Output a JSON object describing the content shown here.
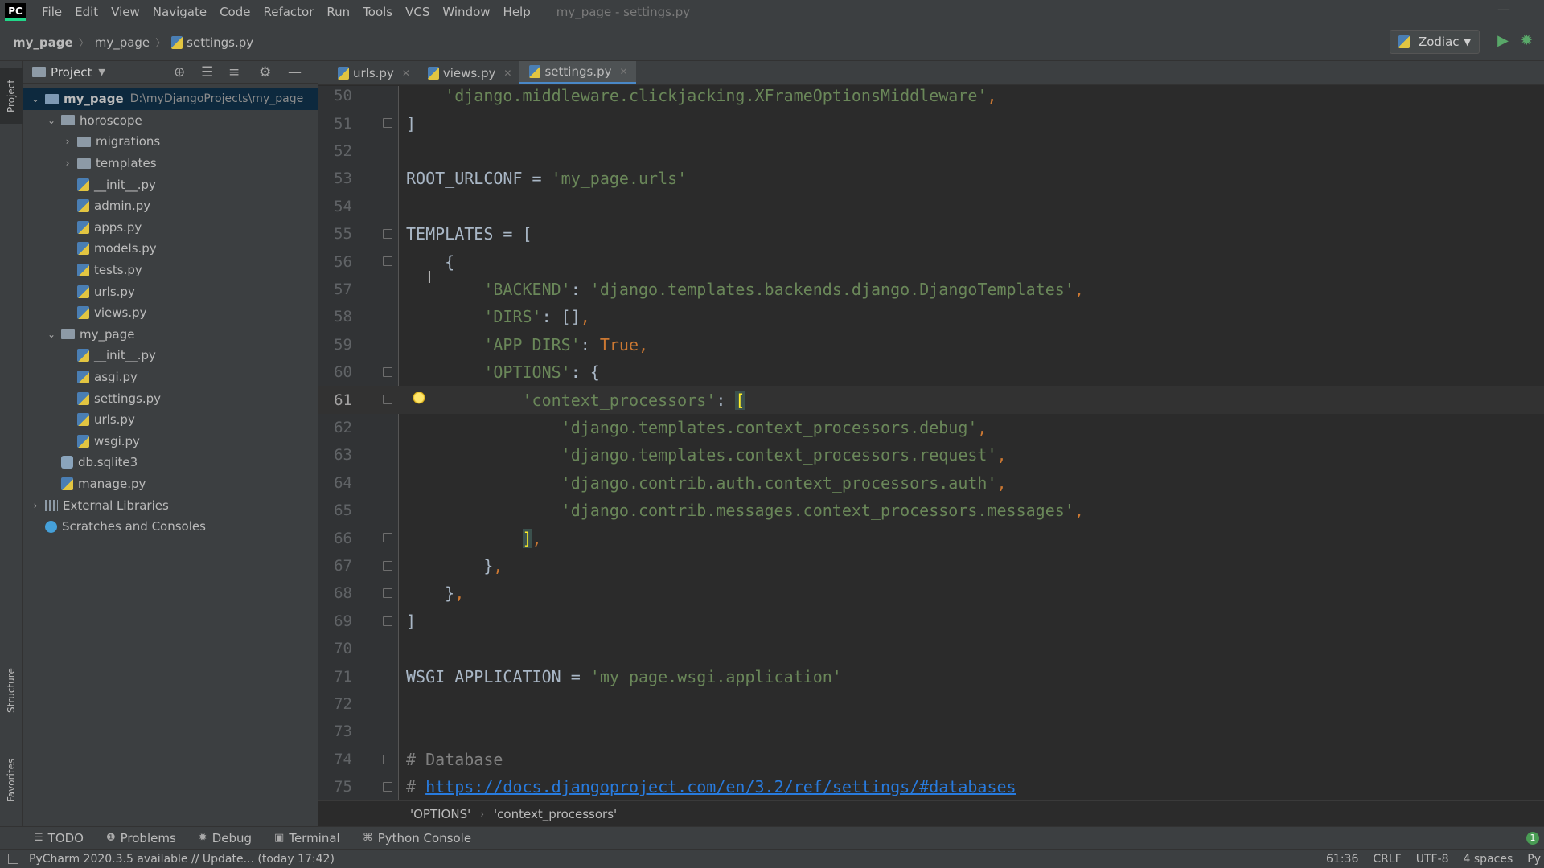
{
  "menubar": {
    "logo": "PC",
    "items": [
      "File",
      "Edit",
      "View",
      "Navigate",
      "Code",
      "Refactor",
      "Run",
      "Tools",
      "VCS",
      "Window",
      "Help"
    ],
    "window_title": "my_page - settings.py"
  },
  "navbar": {
    "crumbs": [
      "my_page",
      "my_page",
      "settings.py"
    ],
    "run_config": "Zodiac"
  },
  "side_tabs": {
    "project": "Project",
    "structure": "Structure",
    "favorites": "Favorites"
  },
  "project_panel": {
    "title": "Project",
    "tree": [
      {
        "label": "my_page",
        "path": "D:\\myDjangoProjects\\my_page",
        "depth": 0,
        "type": "root",
        "expanded": true,
        "selected": true
      },
      {
        "label": "horoscope",
        "depth": 1,
        "type": "folder",
        "expanded": true
      },
      {
        "label": "migrations",
        "depth": 2,
        "type": "folder",
        "expanded": false
      },
      {
        "label": "templates",
        "depth": 2,
        "type": "folder",
        "expanded": false
      },
      {
        "label": "__init__.py",
        "depth": 2,
        "type": "py"
      },
      {
        "label": "admin.py",
        "depth": 2,
        "type": "py"
      },
      {
        "label": "apps.py",
        "depth": 2,
        "type": "py"
      },
      {
        "label": "models.py",
        "depth": 2,
        "type": "py"
      },
      {
        "label": "tests.py",
        "depth": 2,
        "type": "py"
      },
      {
        "label": "urls.py",
        "depth": 2,
        "type": "py"
      },
      {
        "label": "views.py",
        "depth": 2,
        "type": "py"
      },
      {
        "label": "my_page",
        "depth": 1,
        "type": "folder",
        "expanded": true
      },
      {
        "label": "__init__.py",
        "depth": 2,
        "type": "py"
      },
      {
        "label": "asgi.py",
        "depth": 2,
        "type": "py"
      },
      {
        "label": "settings.py",
        "depth": 2,
        "type": "py"
      },
      {
        "label": "urls.py",
        "depth": 2,
        "type": "py"
      },
      {
        "label": "wsgi.py",
        "depth": 2,
        "type": "py"
      },
      {
        "label": "db.sqlite3",
        "depth": 1,
        "type": "db"
      },
      {
        "label": "manage.py",
        "depth": 1,
        "type": "py"
      },
      {
        "label": "External Libraries",
        "depth": 0,
        "type": "lib",
        "expanded": false
      },
      {
        "label": "Scratches and Consoles",
        "depth": 0,
        "type": "scratch"
      }
    ]
  },
  "tabs": [
    {
      "label": "urls.py",
      "active": false
    },
    {
      "label": "views.py",
      "active": false
    },
    {
      "label": "settings.py",
      "active": true
    }
  ],
  "editor": {
    "current_line": 61,
    "lines": [
      {
        "n": "50",
        "html": "    <span class=\"s\">'django.middleware.clickjacking.XFrameOptionsMiddleware'</span><span class=\"k\">,</span>"
      },
      {
        "n": "51",
        "html": "]",
        "fold": true
      },
      {
        "n": "52",
        "html": ""
      },
      {
        "n": "53",
        "html": "ROOT_URLCONF = <span class=\"s\">'my_page.urls'</span>"
      },
      {
        "n": "54",
        "html": ""
      },
      {
        "n": "55",
        "html": "TEMPLATES = [",
        "fold": true
      },
      {
        "n": "56",
        "html": "    {",
        "fold": true
      },
      {
        "n": "57",
        "html": "        <span class=\"s\">'BACKEND'</span>: <span class=\"s\">'django.templates.backends.django.DjangoTemplates'</span><span class=\"k\">,</span>"
      },
      {
        "n": "58",
        "html": "        <span class=\"s\">'DIRS'</span>: []<span class=\"k\">,</span>"
      },
      {
        "n": "59",
        "html": "        <span class=\"s\">'APP_DIRS'</span>: <span class=\"k\">True,</span>"
      },
      {
        "n": "60",
        "html": "        <span class=\"s\">'OPTIONS'</span>: {",
        "fold": true
      },
      {
        "n": "61",
        "html": "            <span class=\"s\">'context_processors'</span>: <span class=\"bk\">[</span>",
        "fold": true,
        "bulb": true
      },
      {
        "n": "62",
        "html": "                <span class=\"s\">'django.templates.context_processors.debug'</span><span class=\"k\">,</span>"
      },
      {
        "n": "63",
        "html": "                <span class=\"s\">'django.templates.context_processors.request'</span><span class=\"k\">,</span>"
      },
      {
        "n": "64",
        "html": "                <span class=\"s\">'django.contrib.auth.context_processors.auth'</span><span class=\"k\">,</span>"
      },
      {
        "n": "65",
        "html": "                <span class=\"s\">'django.contrib.messages.context_processors.messages'</span><span class=\"k\">,</span>"
      },
      {
        "n": "66",
        "html": "            <span class=\"bk\">]</span><span class=\"k\">,</span>",
        "fold": true
      },
      {
        "n": "67",
        "html": "        }<span class=\"k\">,</span>",
        "fold": true
      },
      {
        "n": "68",
        "html": "    }<span class=\"k\">,</span>",
        "fold": true
      },
      {
        "n": "69",
        "html": "]",
        "fold": true
      },
      {
        "n": "70",
        "html": ""
      },
      {
        "n": "71",
        "html": "WSGI_APPLICATION = <span class=\"s\">'my_page.wsgi.application'</span>"
      },
      {
        "n": "72",
        "html": ""
      },
      {
        "n": "73",
        "html": ""
      },
      {
        "n": "74",
        "html": "<span class=\"c\"># Database</span>",
        "fold": true
      },
      {
        "n": "75",
        "html": "<span class=\"c\"># </span><span class=\"u\">https://docs.djangoproject.com/en/3.2/ref/settings/#databases</span>",
        "fold": true
      }
    ]
  },
  "editor_breadcrumb": [
    "'OPTIONS'",
    "'context_processors'"
  ],
  "tool_windows": [
    {
      "label": "TODO",
      "icon": "list-icon"
    },
    {
      "label": "Problems",
      "icon": "problems-icon"
    },
    {
      "label": "Debug",
      "icon": "bug-icon"
    },
    {
      "label": "Terminal",
      "icon": "terminal-icon"
    },
    {
      "label": "Python Console",
      "icon": "python-icon"
    }
  ],
  "statusbar": {
    "message": "PyCharm 2020.3.5 available // Update... (today 17:42)",
    "position": "61:36",
    "line_sep": "CRLF",
    "encoding": "UTF-8",
    "indent": "4 spaces",
    "interpreter": "Py"
  },
  "colors": {
    "accent": "#4a88c7",
    "string": "#6a8759",
    "keyword": "#cc7832",
    "selection": "#0d293e"
  }
}
